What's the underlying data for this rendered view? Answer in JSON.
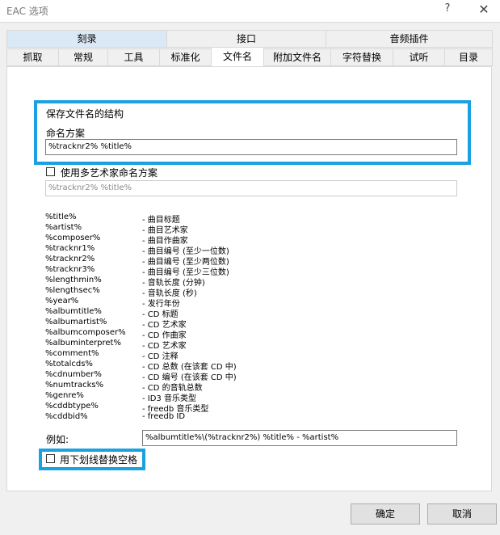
{
  "window": {
    "title": "EAC 选项",
    "help_label": "?",
    "close_label": "✕"
  },
  "tabs": {
    "groups": [
      "刻录",
      "接口",
      "音频插件"
    ],
    "pages": [
      "抓取",
      "常规",
      "工具",
      "标准化",
      "文件名",
      "附加文件名",
      "字符替换",
      "试听",
      "目录"
    ],
    "active": "文件名"
  },
  "filename": {
    "section_title": "保存文件名的结构",
    "naming_label": "命名方案",
    "naming_value": "%tracknr2% %title%",
    "multi_artist_label": "使用多艺术家命名方案",
    "multi_artist_value": "%tracknr2% %title%",
    "variables": [
      {
        "name": "%title%",
        "desc": "- 曲目标题"
      },
      {
        "name": "%artist%",
        "desc": "- 曲目艺术家"
      },
      {
        "name": "%composer%",
        "desc": "- 曲目作曲家"
      },
      {
        "name": "%tracknr1%",
        "desc": "- 曲目编号 (至少一位数)"
      },
      {
        "name": "%tracknr2%",
        "desc": "- 曲目编号 (至少两位数)"
      },
      {
        "name": "%tracknr3%",
        "desc": "- 曲目编号 (至少三位数)"
      },
      {
        "name": "%lengthmin%",
        "desc": "- 音轨长度 (分钟)"
      },
      {
        "name": "%lengthsec%",
        "desc": "- 音轨长度 (秒)"
      },
      {
        "name": "%year%",
        "desc": "- 发行年份"
      },
      {
        "name": "%albumtitle%",
        "desc": "- CD 标题"
      },
      {
        "name": "%albumartist%",
        "desc": "- CD 艺术家"
      },
      {
        "name": "%albumcomposer%",
        "desc": "- CD 作曲家"
      },
      {
        "name": "%albuminterpret%",
        "desc": "- CD 艺术家"
      },
      {
        "name": "%comment%",
        "desc": "- CD 注释"
      },
      {
        "name": "%totalcds%",
        "desc": "- CD 总数 (在该套 CD 中)"
      },
      {
        "name": "%cdnumber%",
        "desc": "- CD 编号 (在该套 CD 中)"
      },
      {
        "name": "%numtracks%",
        "desc": "- CD 的音轨总数"
      },
      {
        "name": "%genre%",
        "desc": "- ID3 音乐类型"
      },
      {
        "name": "%cddbtype%",
        "desc": "- freedb 音乐类型"
      },
      {
        "name": "%cddbid%",
        "desc": "- freedb ID"
      }
    ],
    "example_label": "例如:",
    "example_value": "%albumtitle%\\(%tracknr2%) %title% - %artist%",
    "underscore_label": "用下划线替换空格"
  },
  "buttons": {
    "ok": "确定",
    "cancel": "取消"
  },
  "colors": {
    "highlight": "#1ba1e2",
    "group_tab_selected": "#dbe8f6"
  }
}
